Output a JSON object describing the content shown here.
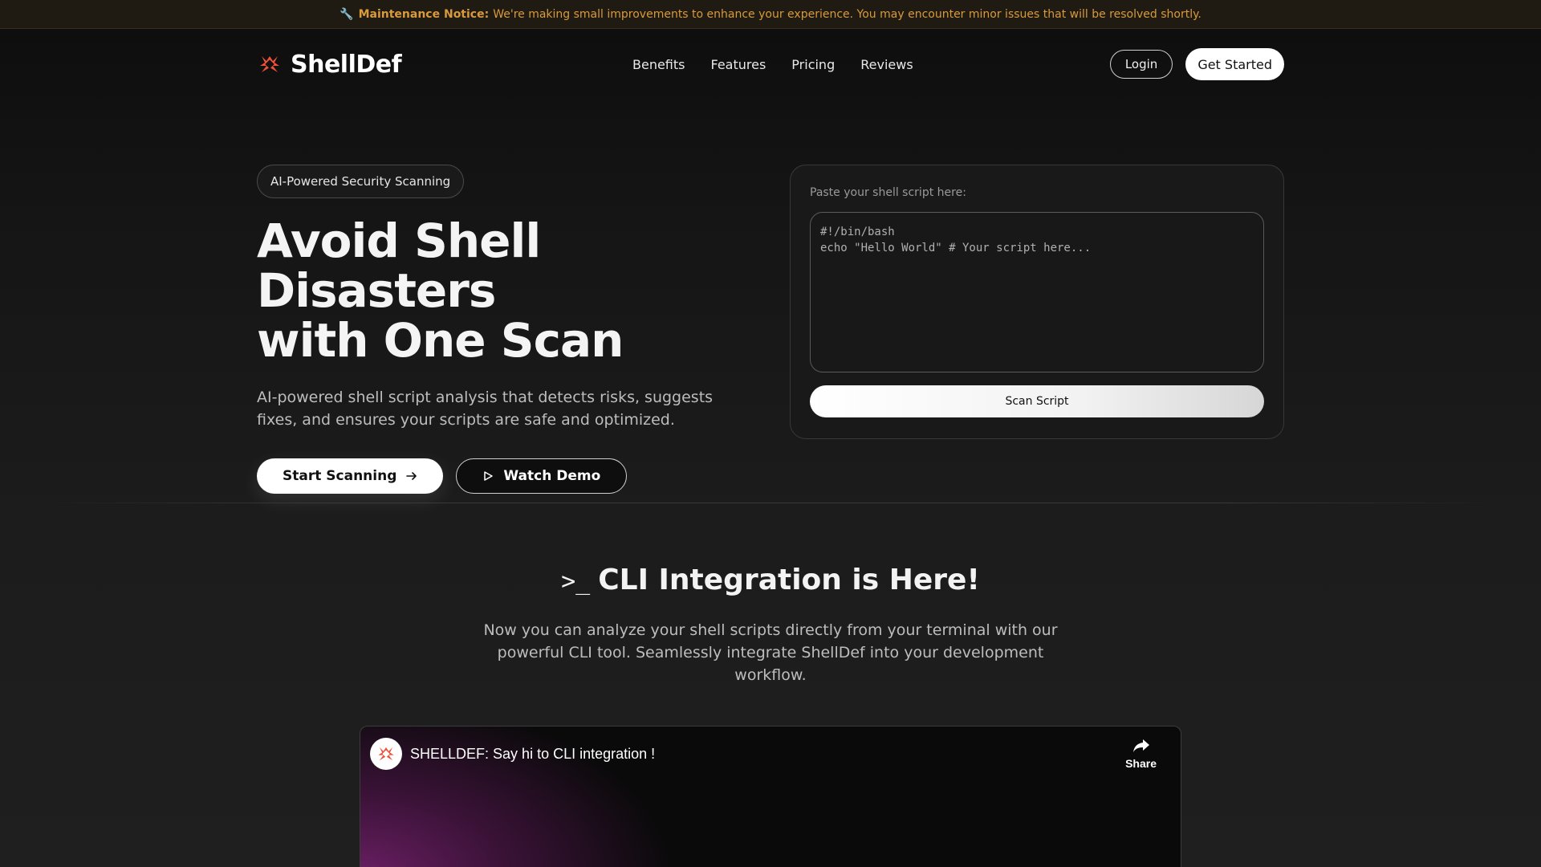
{
  "notice": {
    "icon": "wrench-icon",
    "label": "Maintenance Notice:",
    "text": "We're making small improvements to enhance your experience. You may encounter minor issues that will be resolved shortly."
  },
  "brand": {
    "name": "ShellDef",
    "accent": "#f0503a"
  },
  "nav": {
    "links": [
      "Benefits",
      "Features",
      "Pricing",
      "Reviews"
    ],
    "login": "Login",
    "get_started": "Get Started"
  },
  "hero": {
    "pill": "AI-Powered Security Scanning",
    "title_line1": "Avoid Shell Disasters",
    "title_line2": "with One Scan",
    "subtitle": "AI-powered shell script analysis that detects risks, suggests fixes, and ensures your scripts are safe and optimized.",
    "cta_primary": "Start Scanning",
    "cta_secondary": "Watch Demo"
  },
  "scanner": {
    "label": "Paste your shell script here:",
    "placeholder": "#!/bin/bash\necho \"Hello World\" # Your script here...",
    "button": "Scan Script"
  },
  "cli": {
    "prompt": ">_",
    "title": "CLI Integration is Here!",
    "description": "Now you can analyze your shell scripts directly from your terminal with our powerful CLI tool. Seamlessly integrate ShellDef into your development workflow."
  },
  "video": {
    "title": "SHELLDEF: Say hi to CLI integration !",
    "share": "Share"
  }
}
